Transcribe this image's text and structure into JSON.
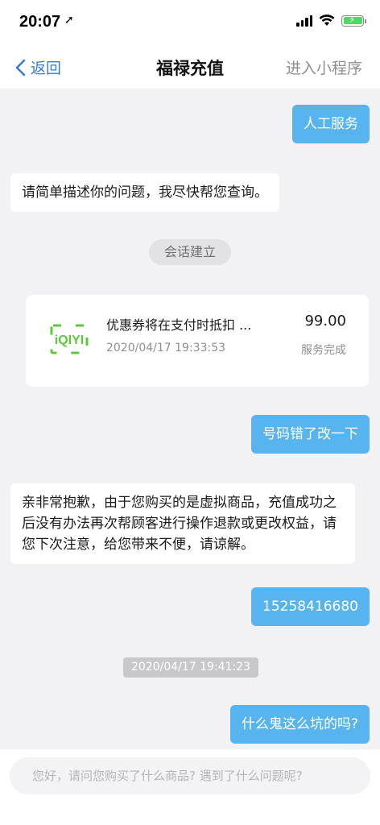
{
  "status_bar": {
    "time": "20:07",
    "location_glyph": "➚",
    "icons": [
      "signal-icon",
      "wifi-icon",
      "battery-charging-icon"
    ]
  },
  "nav": {
    "back_label": "返回",
    "title": "福禄充值",
    "mini_program_label": "进入小程序"
  },
  "messages": {
    "m1": "人工服务",
    "m2": "请简单描述你的问题，我尽快帮您查询。",
    "m3": "会话建立",
    "m5": "号码错了改一下",
    "m6": "亲非常抱歉，由于您购买的是虚拟商品，充值成功之后没有办法再次帮顾客进行操作退款或更改权益，请您下次注意，给您带来不便，请谅解。",
    "m7": "15258416680",
    "m8": "2020/04/17 19:41:23",
    "m9": "什么鬼这么坑的吗?"
  },
  "order": {
    "logo_text": "iQIYI",
    "title": "优惠券将在支付时抵扣 ...",
    "date": "2020/04/17 19:33:53",
    "price": "99.00",
    "status": "服务完成"
  },
  "input": {
    "placeholder": "您好，请问您购买了什么商品? 遇到了什么问题呢?"
  },
  "colors": {
    "user_bubble": "#58b4ee",
    "link_blue": "#3a7bd5",
    "iqiyi_green": "#5ec83a",
    "background": "#f2f2f4"
  }
}
